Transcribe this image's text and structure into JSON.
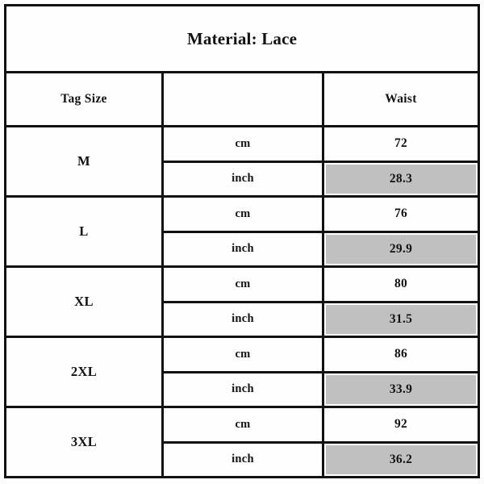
{
  "chart_data": {
    "type": "table",
    "title": "Material:  Lace",
    "columns": [
      "Tag Size",
      "",
      "Waist"
    ],
    "units": [
      "cm",
      "inch"
    ],
    "categories": [
      "M",
      "L",
      "XL",
      "2XL",
      "3XL"
    ],
    "series": [
      {
        "name": "Waist (cm)",
        "values": [
          "72",
          "76",
          "80",
          "86",
          "92"
        ]
      },
      {
        "name": "Waist (inch)",
        "values": [
          "28.3",
          "29.9",
          "31.5",
          "33.9",
          "36.2"
        ]
      }
    ],
    "highlight_color": "#c0c0c0",
    "highlighted_unit": "inch",
    "border_color": "#111111",
    "background_color": "#ffffff"
  },
  "table": {
    "title": "Material:  Lace",
    "header": {
      "tag_size": "Tag Size",
      "unit": "",
      "waist": "Waist"
    },
    "rows": [
      {
        "size": "M",
        "cm_label": "cm",
        "cm_value": "72",
        "inch_label": "inch",
        "inch_value": "28.3"
      },
      {
        "size": "L",
        "cm_label": "cm",
        "cm_value": "76",
        "inch_label": "inch",
        "inch_value": "29.9"
      },
      {
        "size": "XL",
        "cm_label": "cm",
        "cm_value": "80",
        "inch_label": "inch",
        "inch_value": "31.5"
      },
      {
        "size": "2XL",
        "cm_label": "cm",
        "cm_value": "86",
        "inch_label": "inch",
        "inch_value": "33.9"
      },
      {
        "size": "3XL",
        "cm_label": "cm",
        "cm_value": "92",
        "inch_label": "inch",
        "inch_value": "36.2"
      }
    ]
  }
}
